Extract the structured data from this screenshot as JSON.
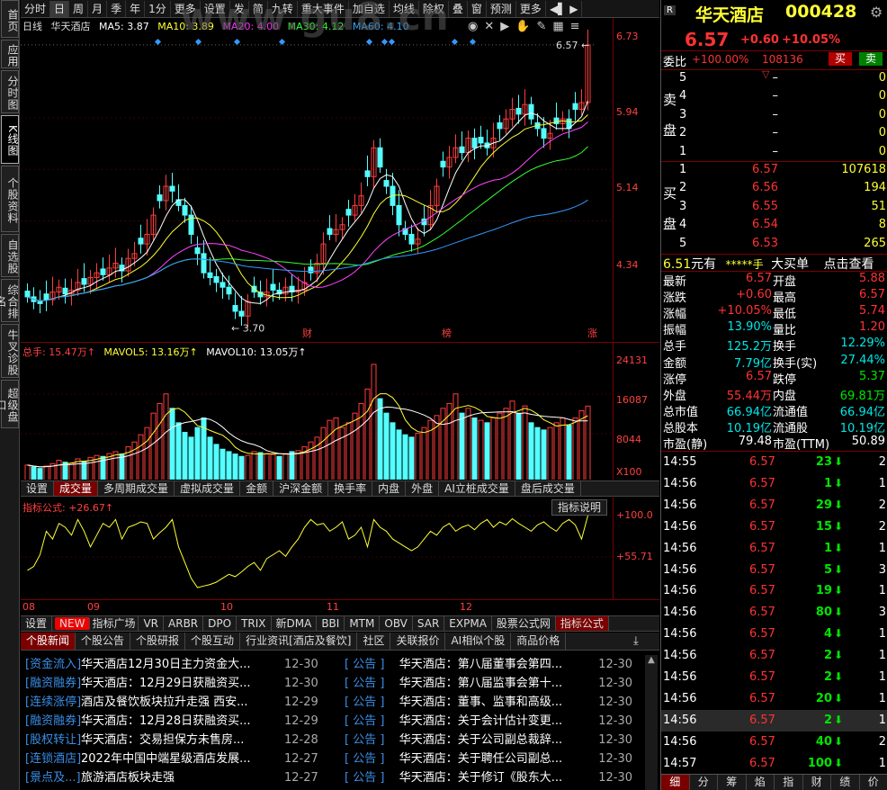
{
  "left_tabs": [
    {
      "label": "首页",
      "active": false
    },
    {
      "label": "应用",
      "active": false
    },
    {
      "label": "分时图",
      "active": false
    },
    {
      "label": "K线图",
      "active": true
    },
    {
      "label": "个股资料",
      "active": false
    },
    {
      "label": "自选股",
      "active": false
    },
    {
      "label": "综合排名",
      "active": false
    },
    {
      "label": "牛叉诊股",
      "active": false
    },
    {
      "label": "超级盘口",
      "active": false
    }
  ],
  "top_toolbar": [
    "分时",
    "日",
    "周",
    "月",
    "季",
    "年",
    "1分",
    "更多",
    "设置",
    "发",
    "简",
    "九转",
    "重大事件",
    "加自选",
    "均线",
    "除权",
    "叠",
    "窗",
    "预测",
    "更多"
  ],
  "watermark": "www.gu8.cn",
  "ma_legend": {
    "period": "日线",
    "name": "华天酒店",
    "ma5": "MA5: 3.87",
    "ma10": "MA10: 3.89",
    "ma20": "MA20: 4.00",
    "ma30": "MA30: 4.12",
    "ma60": "MA60: 4.10"
  },
  "price_axis": [
    "6.73",
    "5.94",
    "5.14",
    "4.34"
  ],
  "price_annotations": {
    "high": "6.57",
    "low": "3.70",
    "marker1": "财",
    "marker2": "榜",
    "marker3": "涨"
  },
  "vol_legend": {
    "total": "总手: 15.47万↑",
    "mavol5": "MAVOL5: 13.16万↑",
    "mavol10": "MAVOL10: 13.05万↑"
  },
  "vol_axis": [
    "24131",
    "16087",
    "8044",
    "X100"
  ],
  "vol_tabs": [
    "设置",
    "成交量",
    "多周期成交量",
    "虚拟成交量",
    "金额",
    "沪深金额",
    "换手率",
    "内盘",
    "外盘",
    "AI立桩成交量",
    "盘后成交量"
  ],
  "ind_legend": "指标公式: +26.67↑",
  "ind_button": "指标说明",
  "ind_axis": [
    "+100.0",
    "+55.71"
  ],
  "date_labels": [
    "08",
    "09",
    "10",
    "11",
    "12"
  ],
  "ind_tabs": [
    "设置",
    "指标广场",
    "VR",
    "ARBR",
    "DPO",
    "TRIX",
    "新DMA",
    "BBI",
    "MTM",
    "OBV",
    "SAR",
    "EXPMA",
    "股票公式网",
    "指标公式"
  ],
  "news_tabs": [
    "个股新闻",
    "个股公告",
    "个股研报",
    "个股互动",
    "行业资讯[酒店及餐饮]",
    "社区",
    "关联报价",
    "AI相似个股",
    "商品价格"
  ],
  "news_left": [
    {
      "tag": "[资金流入]",
      "title": "华天酒店12月30日主力资金大...",
      "date": "12-30"
    },
    {
      "tag": "[融资融券]",
      "title": "华天酒店：12月29日获融资买...",
      "date": "12-30"
    },
    {
      "tag": "[连续涨停]",
      "title": "酒店及餐饮板块拉升走强 西安...",
      "date": "12-29"
    },
    {
      "tag": "[融资融券]",
      "title": "华天酒店：12月28日获融资买...",
      "date": "12-29"
    },
    {
      "tag": "[股权转让]",
      "title": "华天酒店：交易担保方未售房...",
      "date": "12-28"
    },
    {
      "tag": "[连锁酒店]",
      "title": "2022年中国中端星级酒店发展...",
      "date": "12-27"
    },
    {
      "tag": "[景点及...]",
      "title": "旅游酒店板块走强",
      "date": "12-27"
    }
  ],
  "news_right": [
    {
      "tag": "[ 公告 ]",
      "title": "华天酒店：第八届董事会第四...",
      "date": "12-30"
    },
    {
      "tag": "[ 公告 ]",
      "title": "华天酒店：第八届监事会第十...",
      "date": "12-30"
    },
    {
      "tag": "[ 公告 ]",
      "title": "华天酒店：董事、监事和高级...",
      "date": "12-30"
    },
    {
      "tag": "[ 公告 ]",
      "title": "华天酒店：关于会计估计变更...",
      "date": "12-30"
    },
    {
      "tag": "[ 公告 ]",
      "title": "华天酒店：关于公司副总裁辞...",
      "date": "12-30"
    },
    {
      "tag": "[ 公告 ]",
      "title": "华天酒店：关于聘任公司副总...",
      "date": "12-30"
    },
    {
      "tag": "[ 公告 ]",
      "title": "华天酒店：关于修订《股东大...",
      "date": "12-30"
    }
  ],
  "quote": {
    "badge": "R",
    "name": "华天酒店",
    "code": "000428",
    "price": "6.57",
    "change": "+0.60",
    "pct": "+10.05%",
    "weibi_label": "委比",
    "weibi": "+100.00%",
    "weicha": "108136",
    "buy_btn": "买",
    "sell_btn": "卖"
  },
  "sell_book": [
    {
      "lvl": "5",
      "price": "–",
      "vol": "0"
    },
    {
      "lvl": "4",
      "price": "–",
      "vol": "0"
    },
    {
      "lvl": "3",
      "price": "–",
      "vol": "0"
    },
    {
      "lvl": "2",
      "price": "–",
      "vol": "0"
    },
    {
      "lvl": "1",
      "price": "–",
      "vol": "0"
    }
  ],
  "buy_book": [
    {
      "lvl": "1",
      "price": "6.57",
      "vol": "107618"
    },
    {
      "lvl": "2",
      "price": "6.56",
      "vol": "194"
    },
    {
      "lvl": "3",
      "price": "6.55",
      "vol": "51"
    },
    {
      "lvl": "4",
      "price": "6.54",
      "vol": "8"
    },
    {
      "lvl": "5",
      "price": "6.53",
      "vol": "265"
    }
  ],
  "side_labels": {
    "sell1": "卖",
    "sell2": "盘",
    "buy1": "买",
    "buy2": "盘"
  },
  "bigorder": {
    "price": "6.51",
    "unit": "元有",
    "stars": "*****手",
    "label": "大买单",
    "link": "点击查看"
  },
  "stats": [
    {
      "l": "最新",
      "v": "6.57",
      "vc": "red",
      "l2": "开盘",
      "v2": "5.88",
      "v2c": "red"
    },
    {
      "l": "涨跌",
      "v": "+0.60",
      "vc": "red",
      "l2": "最高",
      "v2": "6.57",
      "v2c": "red"
    },
    {
      "l": "涨幅",
      "v": "+10.05%",
      "vc": "red",
      "l2": "最低",
      "v2": "5.74",
      "v2c": "red"
    },
    {
      "l": "振幅",
      "v": "13.90%",
      "vc": "cyan",
      "l2": "量比",
      "v2": "1.20",
      "v2c": "red"
    },
    {
      "l": "总手",
      "v": "125.2万",
      "vc": "cyan",
      "l2": "换手",
      "v2": "12.29%",
      "v2c": "cyan"
    },
    {
      "l": "金额",
      "v": "7.79亿",
      "vc": "cyan",
      "l2": "换手(实)",
      "v2": "27.44%",
      "v2c": "cyan"
    },
    {
      "l": "涨停",
      "v": "6.57",
      "vc": "red",
      "l2": "跌停",
      "v2": "5.37",
      "v2c": "green"
    },
    {
      "l": "外盘",
      "v": "55.44万",
      "vc": "red",
      "l2": "内盘",
      "v2": "69.81万",
      "v2c": "green"
    },
    {
      "l": "总市值",
      "v": "66.94亿",
      "vc": "cyan",
      "l2": "流通值",
      "v2": "66.94亿",
      "v2c": "cyan"
    },
    {
      "l": "总股本",
      "v": "10.19亿",
      "vc": "cyan",
      "l2": "流通股",
      "v2": "10.19亿",
      "v2c": "cyan"
    },
    {
      "l": "市盈(静)",
      "v": "79.48",
      "vc": "white",
      "l2": "市盈(TTM)",
      "v2": "50.89",
      "v2c": "white"
    }
  ],
  "ticks": [
    {
      "t": "14:55",
      "p": "6.57",
      "v": "23",
      "n": "2"
    },
    {
      "t": "14:56",
      "p": "6.57",
      "v": "1",
      "n": "1"
    },
    {
      "t": "14:56",
      "p": "6.57",
      "v": "29",
      "n": "2"
    },
    {
      "t": "14:56",
      "p": "6.57",
      "v": "15",
      "n": "2"
    },
    {
      "t": "14:56",
      "p": "6.57",
      "v": "1",
      "n": "1"
    },
    {
      "t": "14:56",
      "p": "6.57",
      "v": "5",
      "n": "3"
    },
    {
      "t": "14:56",
      "p": "6.57",
      "v": "19",
      "n": "1"
    },
    {
      "t": "14:56",
      "p": "6.57",
      "v": "80",
      "n": "3"
    },
    {
      "t": "14:56",
      "p": "6.57",
      "v": "4",
      "n": "1"
    },
    {
      "t": "14:56",
      "p": "6.57",
      "v": "2",
      "n": "1"
    },
    {
      "t": "14:56",
      "p": "6.57",
      "v": "2",
      "n": "1"
    },
    {
      "t": "14:56",
      "p": "6.57",
      "v": "20",
      "n": "1"
    },
    {
      "t": "14:56",
      "p": "6.57",
      "v": "2",
      "n": "1"
    },
    {
      "t": "14:56",
      "p": "6.57",
      "v": "40",
      "n": "2"
    },
    {
      "t": "14:57",
      "p": "6.57",
      "v": "100",
      "n": "1"
    }
  ],
  "bottom_tabs": [
    "细",
    "分",
    "筹",
    "焰",
    "指",
    "财",
    "绩",
    "价"
  ],
  "chart_data": {
    "type": "candlestick",
    "ylim": [
      3.5,
      6.85
    ],
    "closes": [
      3.95,
      3.9,
      3.88,
      3.92,
      4.0,
      4.05,
      3.98,
      4.02,
      4.1,
      4.08,
      4.15,
      4.2,
      4.18,
      4.25,
      4.3,
      4.22,
      4.35,
      4.4,
      4.5,
      4.6,
      4.8,
      4.95,
      5.1,
      5.05,
      4.9,
      4.8,
      4.6,
      4.4,
      4.2,
      4.15,
      4.1,
      4.05,
      3.98,
      3.8,
      3.75,
      3.9,
      4.0,
      3.95,
      4.0,
      4.02,
      3.98,
      4.05,
      4.0,
      4.02,
      4.1,
      4.2,
      4.3,
      4.5,
      4.6,
      4.65,
      4.7,
      4.8,
      4.9,
      5.0,
      5.2,
      5.5,
      5.3,
      5.1,
      4.9,
      4.7,
      4.6,
      4.5,
      4.55,
      4.7,
      4.9,
      5.1,
      5.3,
      5.4,
      5.5,
      5.45,
      5.6,
      5.5,
      5.55,
      5.5,
      5.6,
      5.7,
      5.8,
      5.9,
      5.85,
      5.95,
      5.8,
      5.7,
      5.6,
      5.65,
      5.75,
      5.8,
      5.7,
      5.9,
      5.97,
      6.57
    ],
    "volumes": [
      3200,
      2800,
      2500,
      3000,
      3500,
      4200,
      3800,
      3600,
      4500,
      4000,
      4800,
      5200,
      5000,
      5600,
      6000,
      5500,
      7000,
      8000,
      9500,
      11000,
      14000,
      16000,
      18000,
      15000,
      12000,
      10000,
      9000,
      11000,
      13000,
      9000,
      7500,
      6500,
      6000,
      5500,
      5000,
      5200,
      6000,
      5800,
      5600,
      5400,
      5000,
      5600,
      6000,
      6200,
      7000,
      8000,
      9000,
      11000,
      12500,
      13000,
      11000,
      12000,
      14000,
      16000,
      19000,
      24131,
      17000,
      14000,
      12000,
      10500,
      9500,
      9000,
      9800,
      11000,
      12500,
      13500,
      15000,
      16000,
      18000,
      14000,
      15000,
      13000,
      12500,
      12000,
      13000,
      14000,
      15000,
      16500,
      14000,
      15500,
      12000,
      11000,
      10500,
      11000,
      12000,
      13000,
      11500,
      13000,
      14500,
      15470
    ],
    "indicator": [
      30,
      35,
      50,
      80,
      70,
      90,
      85,
      75,
      95,
      80,
      60,
      75,
      90,
      85,
      95,
      70,
      85,
      88,
      92,
      90,
      70,
      78,
      85,
      95,
      60,
      40,
      20,
      8,
      10,
      12,
      15,
      20,
      25,
      22,
      28,
      35,
      40,
      30,
      45,
      50,
      55,
      48,
      60,
      70,
      85,
      95,
      88,
      90,
      80,
      85,
      92,
      70,
      75,
      85,
      60,
      95,
      85,
      80,
      70,
      65,
      60,
      55,
      60,
      70,
      80,
      75,
      85,
      90,
      80,
      85,
      88,
      82,
      90,
      95,
      85,
      92,
      88,
      96,
      90,
      85,
      80,
      88,
      92,
      85,
      80,
      90,
      95,
      88,
      70,
      100
    ]
  }
}
